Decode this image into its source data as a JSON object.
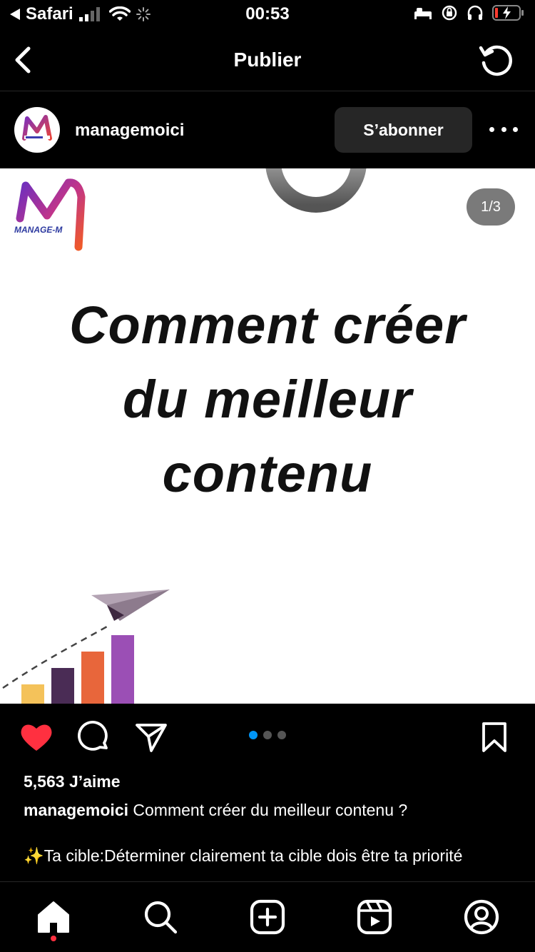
{
  "status_bar": {
    "back_app": "Safari",
    "time": "00:53"
  },
  "nav": {
    "title": "Publier"
  },
  "post": {
    "username": "managemoici",
    "follow_label": "S’abonner",
    "image": {
      "counter": "1/3",
      "headline_line1": "Comment créer",
      "headline_line2": "du meilleur",
      "headline_line3": "contenu",
      "logo_text": "MANAGE-M"
    },
    "carousel": {
      "count": 3,
      "active_index": 0
    },
    "likes": "5,563 J’aime",
    "caption_username": "managemoici",
    "caption_text": "Comment créer du meilleur contenu ?",
    "caption_line2": "✨Ta cible:Déterminer clairement ta cible dois être ta priorité"
  },
  "colors": {
    "like_red": "#ff3040",
    "accent_blue": "#0095f6",
    "button_bg": "#262626"
  },
  "icons": {
    "nav_back": "chevron-left-icon",
    "nav_refresh": "refresh-icon",
    "like": "heart-icon",
    "comment": "comment-icon",
    "share": "paper-plane-icon",
    "save": "bookmark-icon",
    "tabs": [
      "home-icon",
      "search-icon",
      "add-post-icon",
      "reels-icon",
      "profile-icon"
    ]
  }
}
